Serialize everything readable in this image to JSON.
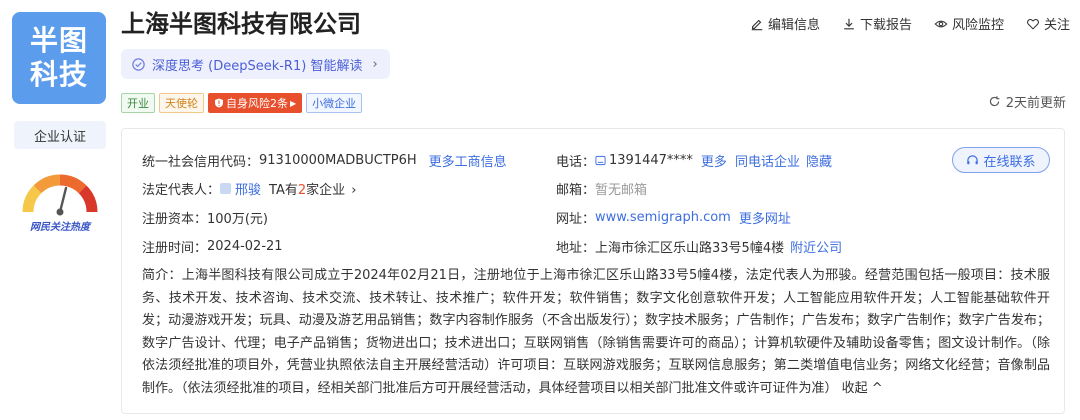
{
  "logo": {
    "line1": "半图",
    "line2": "科技"
  },
  "company_name": "上海半图科技有限公司",
  "header_actions": [
    {
      "label": "编辑信息",
      "icon": "edit-icon"
    },
    {
      "label": "下载报告",
      "icon": "download-icon"
    },
    {
      "label": "风险监控",
      "icon": "eye-icon"
    },
    {
      "label": "关注",
      "icon": "heart-icon"
    }
  ],
  "ai_pill": {
    "label": "深度思考 (DeepSeek-R1) 智能解读",
    "chevron": "›"
  },
  "tags": [
    {
      "label": "开业",
      "style": "green"
    },
    {
      "label": "天使轮",
      "style": "orange"
    },
    {
      "label": "自身风险2条",
      "style": "red"
    },
    {
      "label": "小微企业",
      "style": "blue"
    }
  ],
  "updated": "2天前更新",
  "cert_button": "企业认证",
  "gauge": {
    "label": "网民关注热度",
    "level": 0.55
  },
  "info": {
    "credit_code_label": "统一社会信用代码：",
    "credit_code": "91310000MADBUCTP6H",
    "credit_more": "更多工商信息",
    "legal_label": "法定代表人：",
    "legal_name": "邢骏",
    "legal_ta_prefix": "TA有",
    "legal_ta_count": "2",
    "legal_ta_suffix": "家企业",
    "capital_label": "注册资本：",
    "capital": "100万(元)",
    "reg_time_label": "注册时间：",
    "reg_time": "2024-02-21",
    "phone_label": "电话：",
    "phone": "1391447****",
    "phone_more": "更多",
    "phone_same": "同电话企业",
    "phone_hide": "隐藏",
    "email_label": "邮箱：",
    "email": "暂无邮箱",
    "website_label": "网址：",
    "website": "www.semigraph.com",
    "website_more": "更多网址",
    "address_label": "地址：",
    "address": "上海市徐汇区乐山路33号5幢4楼",
    "address_nearby": "附近公司",
    "contact_button": "在线联系"
  },
  "intro": {
    "text": "简介：上海半图科技有限公司成立于2024年02月21日，注册地位于上海市徐汇区乐山路33号5幢4楼，法定代表人为邢骏。经营范围包括一般项目：技术服务、技术开发、技术咨询、技术交流、技术转让、技术推广；软件开发；软件销售；数字文化创意软件开发；人工智能应用软件开发；人工智能基础软件开发；动漫游戏开发；玩具、动漫及游艺用品销售；数字内容制作服务（不含出版发行）；数字技术服务；广告制作；广告发布；数字广告制作；数字广告发布；数字广告设计、代理；电子产品销售；货物进出口；技术进出口；互联网销售（除销售需要许可的商品）；计算机软硬件及辅助设备零售；图文设计制作。（除依法须经批准的项目外，凭营业执照依法自主开展经营活动）许可项目：互联网游戏服务；互联网信息服务；第二类增值电信业务；网络文化经营；音像制品制作。（依法须经批准的项目，经相关部门批准后方可开展经营活动，具体经营项目以相关部门批准文件或许可证件为准）",
    "collapse": "收起 ^"
  },
  "colors": {
    "accent": "#3d6ee0",
    "logo_bg": "#5b9cec",
    "risk_red": "#e8502d"
  }
}
